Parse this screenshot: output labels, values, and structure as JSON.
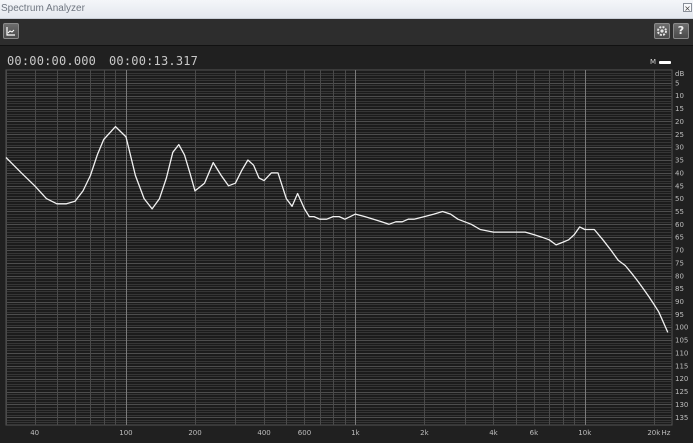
{
  "window": {
    "title": "Spectrum Analyzer",
    "close_glyph": "×"
  },
  "toolbar": {
    "left_icon": "graph-view-icon",
    "right_icons": [
      "settings-gear-icon",
      "help-icon"
    ],
    "help_glyph": "?"
  },
  "timeline": {
    "start": "00:00:00.000",
    "end": "00:00:13.317"
  },
  "legend": {
    "label": "M",
    "color": "#ffffff"
  },
  "colors": {
    "background": "#202020",
    "plot": "#1c1c1c",
    "grid": "#4a4a4a",
    "trace": "#f2f2f2"
  },
  "chart_data": {
    "type": "line",
    "title": "",
    "x_scale": "log",
    "xlim": [
      30,
      24000
    ],
    "ylim_dB": [
      0,
      138
    ],
    "xunit": "Hz",
    "yunit": "dB",
    "x_tick_labels": [
      "40",
      "100",
      "200",
      "400",
      "600",
      "1k",
      "2k",
      "4k",
      "6k",
      "10k",
      "20k"
    ],
    "x_tick_values": [
      40,
      100,
      200,
      400,
      600,
      1000,
      2000,
      4000,
      6000,
      10000,
      20000
    ],
    "y_tick_labels": [
      "5",
      "10",
      "15",
      "20",
      "25",
      "30",
      "35",
      "40",
      "45",
      "50",
      "55",
      "60",
      "65",
      "70",
      "75",
      "80",
      "85",
      "90",
      "95",
      "100",
      "105",
      "110",
      "115",
      "120",
      "125",
      "130",
      "135"
    ],
    "y_tick_values": [
      5,
      10,
      15,
      20,
      25,
      30,
      35,
      40,
      45,
      50,
      55,
      60,
      65,
      70,
      75,
      80,
      85,
      90,
      95,
      100,
      105,
      110,
      115,
      120,
      125,
      130,
      135
    ],
    "series": [
      {
        "color": "#f2f2f2",
        "x": [
          30,
          35,
          40,
          45,
          50,
          55,
          60,
          65,
          70,
          75,
          80,
          90,
          100,
          110,
          120,
          130,
          140,
          150,
          160,
          170,
          180,
          190,
          200,
          220,
          240,
          260,
          280,
          300,
          320,
          340,
          360,
          380,
          400,
          430,
          460,
          500,
          530,
          560,
          600,
          630,
          660,
          700,
          750,
          800,
          850,
          900,
          950,
          1000,
          1100,
          1200,
          1300,
          1400,
          1500,
          1600,
          1700,
          1800,
          2000,
          2200,
          2400,
          2600,
          2800,
          3000,
          3200,
          3500,
          4000,
          4500,
          5000,
          5500,
          6000,
          6500,
          7000,
          7500,
          8000,
          8500,
          9000,
          9500,
          10000,
          11000,
          12000,
          13000,
          14000,
          15000,
          16000,
          17000,
          18000,
          19000,
          20000,
          21000,
          22000,
          23000
        ],
        "y": [
          34,
          40,
          45,
          50,
          52,
          52,
          51,
          47,
          41,
          33,
          27,
          22,
          26,
          41,
          50,
          54,
          50,
          42,
          32,
          29,
          33,
          40,
          47,
          44,
          36,
          41,
          45,
          44,
          39,
          35,
          37,
          42,
          43,
          40,
          40,
          50,
          53,
          48,
          54,
          57,
          57,
          58,
          58,
          57,
          57,
          58,
          57,
          56,
          57,
          58,
          59,
          60,
          59,
          59,
          58,
          58,
          57,
          56,
          55,
          56,
          58,
          59,
          60,
          62,
          63,
          63,
          63,
          63,
          64,
          65,
          66,
          68,
          67,
          66,
          64,
          61,
          62,
          62,
          66,
          70,
          74,
          76,
          79,
          82,
          85,
          88,
          91,
          94,
          98,
          102
        ]
      }
    ]
  }
}
